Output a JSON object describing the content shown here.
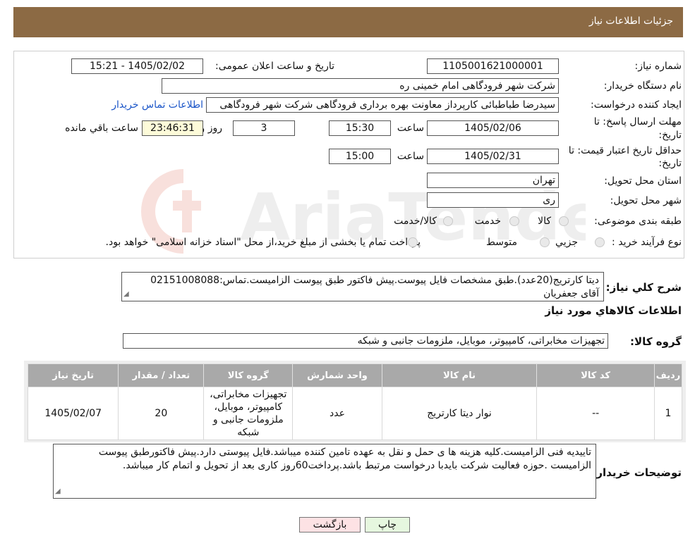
{
  "header": {
    "title": "جزئیات اطلاعات نیاز"
  },
  "form": {
    "need_number": {
      "label": "شماره نیاز:",
      "value": "1105001621000001"
    },
    "announce_datetime": {
      "label": "تاریخ و ساعت اعلان عمومی:",
      "value": "1405/02/02 - 15:21"
    },
    "buyer_org": {
      "label": "نام دستگاه خریدار:",
      "value": "شرکت شهر فرودگاهی امام خمینی  ره"
    },
    "requester": {
      "label": "ایجاد کننده درخواست:",
      "value": "سیدرضا طباطبائی کارپرداز معاونت بهره برداری فرودگاهی شرکت شهر فرودگاهی",
      "contact_link": "اطلاعات تماس خریدار"
    },
    "response_deadline": {
      "label_line1": "مهلت ارسال پاسخ: تا",
      "label_line2": "تاریخ:",
      "date": "1405/02/06",
      "time_label": "ساعت",
      "time": "15:30",
      "days": "3",
      "days_label": "روز و",
      "remaining": "23:46:31",
      "remaining_label": "ساعت باقي مانده"
    },
    "price_validity": {
      "label_line1": "حداقل تاریخ اعتبار قیمت: تا",
      "label_line2": "تاریخ:",
      "date": "1405/02/31",
      "time_label": "ساعت",
      "time": "15:00"
    },
    "delivery_province": {
      "label": "استان محل تحویل:",
      "value": "تهران"
    },
    "delivery_city": {
      "label": "شهر محل تحویل:",
      "value": "ری"
    },
    "category": {
      "label": "طبقه بندی موضوعی:",
      "options": [
        "کالا",
        "خدمت",
        "کالا/خدمت"
      ]
    },
    "purchase_type": {
      "label": "نوع فرآیند خرید :",
      "options": [
        "جزیي",
        "متوسط"
      ],
      "note": "پرداخت تمام یا بخشی از مبلغ خرید،از محل \"اسناد خزانه اسلامی\" خواهد بود."
    }
  },
  "summary": {
    "label": "شرح کلي نیاز:",
    "line1": "دیتا کارتریج(20عدد).طبق مشخصات فایل پیوست.پیش فاکتور طبق پیوست الزامیست.تماس:02151008088",
    "line2": "آقای جعفریان"
  },
  "goods_info_title": "اطلاعات کالاهاي مورد نیاز",
  "goods_group": {
    "label": "گروه کالا:",
    "value": "تجهیزات مخابراتی، کامپیوتر، موبایل، ملزومات جانبی و شبکه"
  },
  "table": {
    "headers": [
      "ردیف",
      "کد کالا",
      "نام کالا",
      "واحد شمارش",
      "گروه کالا",
      "تعداد / مقدار",
      "تاریخ نیاز"
    ],
    "rows": [
      [
        "1",
        "--",
        "نوار دیتا کارتریج",
        "عدد",
        "تجهیزات مخابراتی، کامپیوتر، موبایل، ملزومات جانبی و شبکه",
        "20",
        "1405/02/07"
      ]
    ]
  },
  "buyer_notes": {
    "label": "توضیحات خریدار:",
    "text": "تاییدیه فنی الزامیست.کلیه هزینه ها ی حمل و نقل به عهده تامین کننده میباشد.فایل پیوستی دارد.پیش فاکتورطبق پیوست الزامیست .حوزه فعالیت شرکت بایدبا درخواست مرتبط باشد.پرداخت60روز کاری بعد از تحویل و اتمام کار میباشد."
  },
  "buttons": {
    "print": "چاپ",
    "back": "بازگشت"
  },
  "watermark": {
    "text": "AriaTender.neT"
  }
}
